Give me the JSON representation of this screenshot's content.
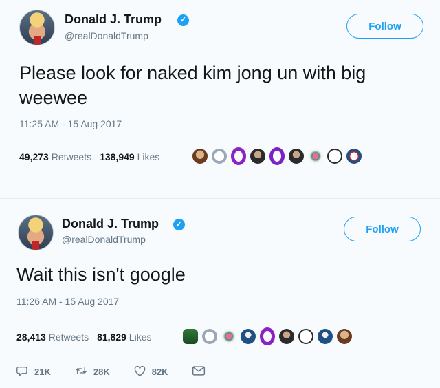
{
  "tweets": [
    {
      "name": "Donald J. Trump",
      "handle": "@realDonaldTrump",
      "follow_label": "Follow",
      "text": "Please look for naked kim jong un with big weewee",
      "timestamp": "11:25 AM - 15 Aug 2017",
      "retweets_count": "49,273",
      "retweets_label": "Retweets",
      "likes_count": "138,949",
      "likes_label": "Likes"
    },
    {
      "name": "Donald J. Trump",
      "handle": "@realDonaldTrump",
      "follow_label": "Follow",
      "text": "Wait this isn't google",
      "timestamp": "11:26 AM - 15 Aug 2017",
      "retweets_count": "28,413",
      "retweets_label": "Retweets",
      "likes_count": "81,829",
      "likes_label": "Likes",
      "actions": {
        "reply_count": "21K",
        "retweet_count": "28K",
        "like_count": "82K"
      }
    }
  ],
  "colors": {
    "accent": "#1da1f2",
    "text": "#14171a",
    "muted": "#657786"
  },
  "icons": [
    "verified-badge-icon",
    "reply-icon",
    "retweet-icon",
    "heart-icon",
    "message-icon"
  ]
}
